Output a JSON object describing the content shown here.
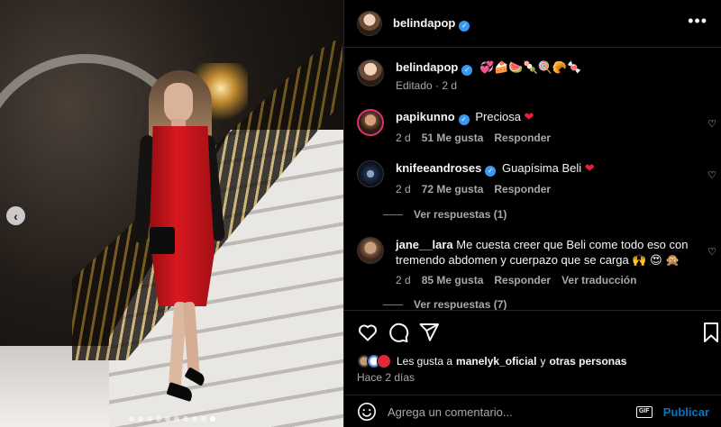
{
  "carousel": {
    "prev_icon": "‹",
    "dot_count": 10,
    "active_dot": 9
  },
  "header": {
    "username": "belindapop",
    "more_icon": "•••"
  },
  "caption": {
    "username": "belindapop",
    "emojis": "💞🍰🍉🍡🍭🥐🍬",
    "edited": "Editado",
    "time": "2 d"
  },
  "comments": [
    {
      "username": "papikunno",
      "verified": true,
      "text": "Preciosa",
      "emoji": "❤",
      "time": "2 d",
      "likes": "51 Me gusta",
      "reply": "Responder"
    },
    {
      "username": "knifeeandroses",
      "verified": true,
      "text": "Guapísima Beli",
      "emoji": "❤",
      "time": "2 d",
      "likes": "72 Me gusta",
      "reply": "Responder",
      "view_replies": "Ver respuestas (1)"
    },
    {
      "username": "jane__lara",
      "verified": false,
      "text": "Me cuesta creer que Beli come todo eso con tremendo abdomen y cuerpazo que se carga 🙌 😍 🙊",
      "time": "2 d",
      "likes": "85 Me gusta",
      "reply": "Responder",
      "translate": "Ver traducción",
      "view_replies": "Ver respuestas (7)"
    }
  ],
  "likes": {
    "prefix": "Les gusta a",
    "user": "manelyk_oficial",
    "connector": "y",
    "others": "otras personas"
  },
  "timestamp": "Hace 2 días",
  "composer": {
    "placeholder": "Agrega un comentario...",
    "gif_label": "GIF",
    "post_label": "Publicar"
  },
  "colors": {
    "accent": "#0095f6",
    "verified": "#3897f0",
    "heart_red": "#ed1e3a",
    "background": "#000000"
  }
}
